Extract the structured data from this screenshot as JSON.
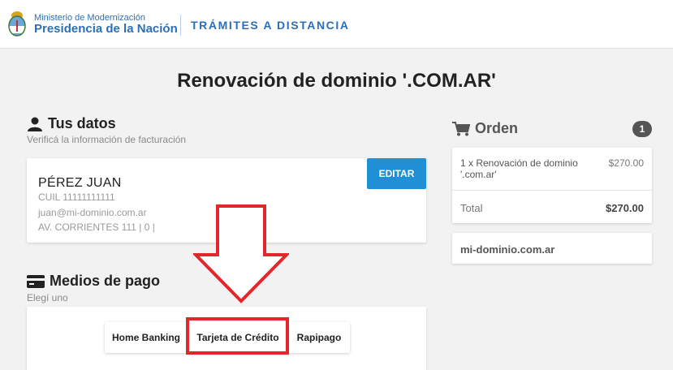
{
  "header": {
    "ministry": "Ministerio de Modernización",
    "presidency": "Presidencia de la Nación",
    "service": "TRÁMITES A DISTANCIA"
  },
  "page": {
    "title": "Renovación de dominio '.COM.AR'"
  },
  "user_section": {
    "title": "Tus datos",
    "subtitle": "Verificá la información de facturación",
    "name": "PÉREZ JUAN",
    "cuil": "CUIL 11111111111",
    "email": "juan@mi-dominio.com.ar",
    "address": "AV. CORRIENTES 111 | 0 |",
    "edit_label": "EDITAR"
  },
  "order": {
    "title": "Orden",
    "badge": "1",
    "item": "1 x Renovación de dominio '.com.ar'",
    "item_price": "$270.00",
    "total_label": "Total",
    "total_value": "$270.00",
    "domain": "mi-dominio.com.ar"
  },
  "payment": {
    "title": "Medios de pago",
    "subtitle": "Elegí uno",
    "tabs": [
      "Home Banking",
      "Tarjeta de Crédito",
      "Rapipago"
    ]
  },
  "colors": {
    "brand_blue": "#2b6fb6",
    "button_blue": "#1f8fd6",
    "highlight_red": "#e3262c"
  },
  "icons": [
    "argentina-seal-icon",
    "user-icon",
    "cart-icon",
    "credit-card-icon",
    "down-arrow-annotation"
  ]
}
